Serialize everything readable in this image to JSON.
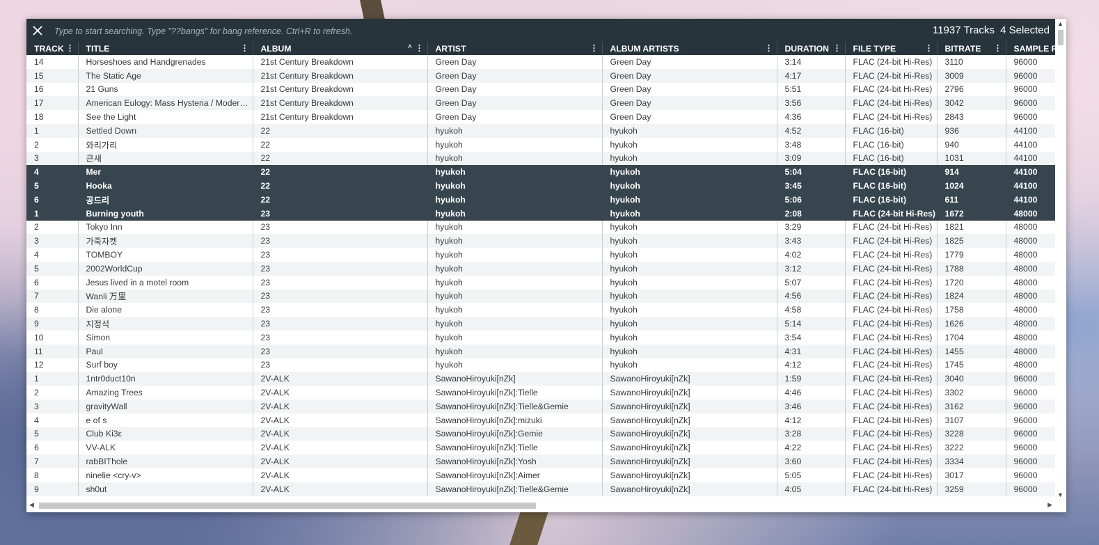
{
  "search": {
    "placeholder": "Type to start searching. Type \"??bangs\" for bang reference. Ctrl+R to refresh."
  },
  "status": {
    "tracks": "11937 Tracks",
    "selected": "4 Selected"
  },
  "columns": [
    "TRACK",
    "TITLE",
    "ALBUM",
    "ARTIST",
    "ALBUM ARTISTS",
    "DURATION",
    "FILE TYPE",
    "BITRATE",
    "SAMPLE R"
  ],
  "sorted_column": "ALBUM",
  "rows": [
    {
      "track": "14",
      "title": "Horseshoes and Handgrenades",
      "album": "21st Century Breakdown",
      "artist": "Green Day",
      "album_artists": "Green Day",
      "duration": "3:14",
      "file_type": "FLAC (24-bit Hi-Res)",
      "bitrate": "3110",
      "sample_rate": "96000",
      "selected": false
    },
    {
      "track": "15",
      "title": "The Static Age",
      "album": "21st Century Breakdown",
      "artist": "Green Day",
      "album_artists": "Green Day",
      "duration": "4:17",
      "file_type": "FLAC (24-bit Hi-Res)",
      "bitrate": "3009",
      "sample_rate": "96000",
      "selected": false
    },
    {
      "track": "16",
      "title": "21 Guns",
      "album": "21st Century Breakdown",
      "artist": "Green Day",
      "album_artists": "Green Day",
      "duration": "5:51",
      "file_type": "FLAC (24-bit Hi-Res)",
      "bitrate": "2796",
      "sample_rate": "96000",
      "selected": false
    },
    {
      "track": "17",
      "title": "American Eulogy: Mass Hysteria / Modern ...",
      "album": "21st Century Breakdown",
      "artist": "Green Day",
      "album_artists": "Green Day",
      "duration": "3:56",
      "file_type": "FLAC (24-bit Hi-Res)",
      "bitrate": "3042",
      "sample_rate": "96000",
      "selected": false
    },
    {
      "track": "18",
      "title": "See the Light",
      "album": "21st Century Breakdown",
      "artist": "Green Day",
      "album_artists": "Green Day",
      "duration": "4:36",
      "file_type": "FLAC (24-bit Hi-Res)",
      "bitrate": "2843",
      "sample_rate": "96000",
      "selected": false
    },
    {
      "track": "1",
      "title": "Settled Down",
      "album": "22",
      "artist": "hyukoh",
      "album_artists": "hyukoh",
      "duration": "4:52",
      "file_type": "FLAC (16-bit)",
      "bitrate": "936",
      "sample_rate": "44100",
      "selected": false
    },
    {
      "track": "2",
      "title": "와리가리",
      "album": "22",
      "artist": "hyukoh",
      "album_artists": "hyukoh",
      "duration": "3:48",
      "file_type": "FLAC (16-bit)",
      "bitrate": "940",
      "sample_rate": "44100",
      "selected": false
    },
    {
      "track": "3",
      "title": "큰새",
      "album": "22",
      "artist": "hyukoh",
      "album_artists": "hyukoh",
      "duration": "3:09",
      "file_type": "FLAC (16-bit)",
      "bitrate": "1031",
      "sample_rate": "44100",
      "selected": false
    },
    {
      "track": "4",
      "title": "Mer",
      "album": "22",
      "artist": "hyukoh",
      "album_artists": "hyukoh",
      "duration": "5:04",
      "file_type": "FLAC (16-bit)",
      "bitrate": "914",
      "sample_rate": "44100",
      "selected": true
    },
    {
      "track": "5",
      "title": "Hooka",
      "album": "22",
      "artist": "hyukoh",
      "album_artists": "hyukoh",
      "duration": "3:45",
      "file_type": "FLAC (16-bit)",
      "bitrate": "1024",
      "sample_rate": "44100",
      "selected": true
    },
    {
      "track": "6",
      "title": "공드리",
      "album": "22",
      "artist": "hyukoh",
      "album_artists": "hyukoh",
      "duration": "5:06",
      "file_type": "FLAC (16-bit)",
      "bitrate": "611",
      "sample_rate": "44100",
      "selected": true
    },
    {
      "track": "1",
      "title": "Burning youth",
      "album": "23",
      "artist": "hyukoh",
      "album_artists": "hyukoh",
      "duration": "2:08",
      "file_type": "FLAC (24-bit Hi-Res)",
      "bitrate": "1672",
      "sample_rate": "48000",
      "selected": true
    },
    {
      "track": "2",
      "title": "Tokyo Inn",
      "album": "23",
      "artist": "hyukoh",
      "album_artists": "hyukoh",
      "duration": "3:29",
      "file_type": "FLAC (24-bit Hi-Res)",
      "bitrate": "1821",
      "sample_rate": "48000",
      "selected": false
    },
    {
      "track": "3",
      "title": "가죽자켓",
      "album": "23",
      "artist": "hyukoh",
      "album_artists": "hyukoh",
      "duration": "3:43",
      "file_type": "FLAC (24-bit Hi-Res)",
      "bitrate": "1825",
      "sample_rate": "48000",
      "selected": false
    },
    {
      "track": "4",
      "title": "TOMBOY",
      "album": "23",
      "artist": "hyukoh",
      "album_artists": "hyukoh",
      "duration": "4:02",
      "file_type": "FLAC (24-bit Hi-Res)",
      "bitrate": "1779",
      "sample_rate": "48000",
      "selected": false
    },
    {
      "track": "5",
      "title": "2002WorldCup",
      "album": "23",
      "artist": "hyukoh",
      "album_artists": "hyukoh",
      "duration": "3:12",
      "file_type": "FLAC (24-bit Hi-Res)",
      "bitrate": "1788",
      "sample_rate": "48000",
      "selected": false
    },
    {
      "track": "6",
      "title": "Jesus lived in a motel room",
      "album": "23",
      "artist": "hyukoh",
      "album_artists": "hyukoh",
      "duration": "5:07",
      "file_type": "FLAC (24-bit Hi-Res)",
      "bitrate": "1720",
      "sample_rate": "48000",
      "selected": false
    },
    {
      "track": "7",
      "title": "Wanli 万里",
      "album": "23",
      "artist": "hyukoh",
      "album_artists": "hyukoh",
      "duration": "4:56",
      "file_type": "FLAC (24-bit Hi-Res)",
      "bitrate": "1824",
      "sample_rate": "48000",
      "selected": false
    },
    {
      "track": "8",
      "title": "Die alone",
      "album": "23",
      "artist": "hyukoh",
      "album_artists": "hyukoh",
      "duration": "4:58",
      "file_type": "FLAC (24-bit Hi-Res)",
      "bitrate": "1758",
      "sample_rate": "48000",
      "selected": false
    },
    {
      "track": "9",
      "title": "지정석",
      "album": "23",
      "artist": "hyukoh",
      "album_artists": "hyukoh",
      "duration": "5:14",
      "file_type": "FLAC (24-bit Hi-Res)",
      "bitrate": "1626",
      "sample_rate": "48000",
      "selected": false
    },
    {
      "track": "10",
      "title": "Simon",
      "album": "23",
      "artist": "hyukoh",
      "album_artists": "hyukoh",
      "duration": "3:54",
      "file_type": "FLAC (24-bit Hi-Res)",
      "bitrate": "1704",
      "sample_rate": "48000",
      "selected": false
    },
    {
      "track": "11",
      "title": "Paul",
      "album": "23",
      "artist": "hyukoh",
      "album_artists": "hyukoh",
      "duration": "4:31",
      "file_type": "FLAC (24-bit Hi-Res)",
      "bitrate": "1455",
      "sample_rate": "48000",
      "selected": false
    },
    {
      "track": "12",
      "title": "Surf boy",
      "album": "23",
      "artist": "hyukoh",
      "album_artists": "hyukoh",
      "duration": "4:12",
      "file_type": "FLAC (24-bit Hi-Res)",
      "bitrate": "1745",
      "sample_rate": "48000",
      "selected": false
    },
    {
      "track": "1",
      "title": "1ntr0duct10n",
      "album": "2V-ALK",
      "artist": "SawanoHiroyuki[nZk]",
      "album_artists": "SawanoHiroyuki[nZk]",
      "duration": "1:59",
      "file_type": "FLAC (24-bit Hi-Res)",
      "bitrate": "3040",
      "sample_rate": "96000",
      "selected": false
    },
    {
      "track": "2",
      "title": "Amazing Trees",
      "album": "2V-ALK",
      "artist": "SawanoHiroyuki[nZk]:Tielle",
      "album_artists": "SawanoHiroyuki[nZk]",
      "duration": "4:46",
      "file_type": "FLAC (24-bit Hi-Res)",
      "bitrate": "3302",
      "sample_rate": "96000",
      "selected": false
    },
    {
      "track": "3",
      "title": "gravityWall",
      "album": "2V-ALK",
      "artist": "SawanoHiroyuki[nZk]:Tielle&Gemie",
      "album_artists": "SawanoHiroyuki[nZk]",
      "duration": "3:46",
      "file_type": "FLAC (24-bit Hi-Res)",
      "bitrate": "3162",
      "sample_rate": "96000",
      "selected": false
    },
    {
      "track": "4",
      "title": "e of s",
      "album": "2V-ALK",
      "artist": "SawanoHiroyuki[nZk]:mizuki",
      "album_artists": "SawanoHiroyuki[nZk]",
      "duration": "4:12",
      "file_type": "FLAC (24-bit Hi-Res)",
      "bitrate": "3107",
      "sample_rate": "96000",
      "selected": false
    },
    {
      "track": "5",
      "title": "Club Ki3ε",
      "album": "2V-ALK",
      "artist": "SawanoHiroyuki[nZk]:Gemie",
      "album_artists": "SawanoHiroyuki[nZk]",
      "duration": "3:28",
      "file_type": "FLAC (24-bit Hi-Res)",
      "bitrate": "3228",
      "sample_rate": "96000",
      "selected": false
    },
    {
      "track": "6",
      "title": "VV-ALK",
      "album": "2V-ALK",
      "artist": "SawanoHiroyuki[nZk]:Tielle",
      "album_artists": "SawanoHiroyuki[nZk]",
      "duration": "4:22",
      "file_type": "FLAC (24-bit Hi-Res)",
      "bitrate": "3222",
      "sample_rate": "96000",
      "selected": false
    },
    {
      "track": "7",
      "title": "rabBIThole",
      "album": "2V-ALK",
      "artist": "SawanoHiroyuki[nZk]:Yosh",
      "album_artists": "SawanoHiroyuki[nZk]",
      "duration": "3:60",
      "file_type": "FLAC (24-bit Hi-Res)",
      "bitrate": "3334",
      "sample_rate": "96000",
      "selected": false
    },
    {
      "track": "8",
      "title": "ninelie <cry-v>",
      "album": "2V-ALK",
      "artist": "SawanoHiroyuki[nZk]:Aimer",
      "album_artists": "SawanoHiroyuki[nZk]",
      "duration": "5:05",
      "file_type": "FLAC (24-bit Hi-Res)",
      "bitrate": "3017",
      "sample_rate": "96000",
      "selected": false
    },
    {
      "track": "9",
      "title": "sh0ut",
      "album": "2V-ALK",
      "artist": "SawanoHiroyuki[nZk]:Tielle&Gemie",
      "album_artists": "SawanoHiroyuki[nZk]",
      "duration": "4:05",
      "file_type": "FLAC (24-bit Hi-Res)",
      "bitrate": "3259",
      "sample_rate": "96000",
      "selected": false
    }
  ],
  "colors": {
    "header_bg": "#28343c",
    "selected_bg": "#37454e",
    "row_alt": "#f2f3f4"
  }
}
